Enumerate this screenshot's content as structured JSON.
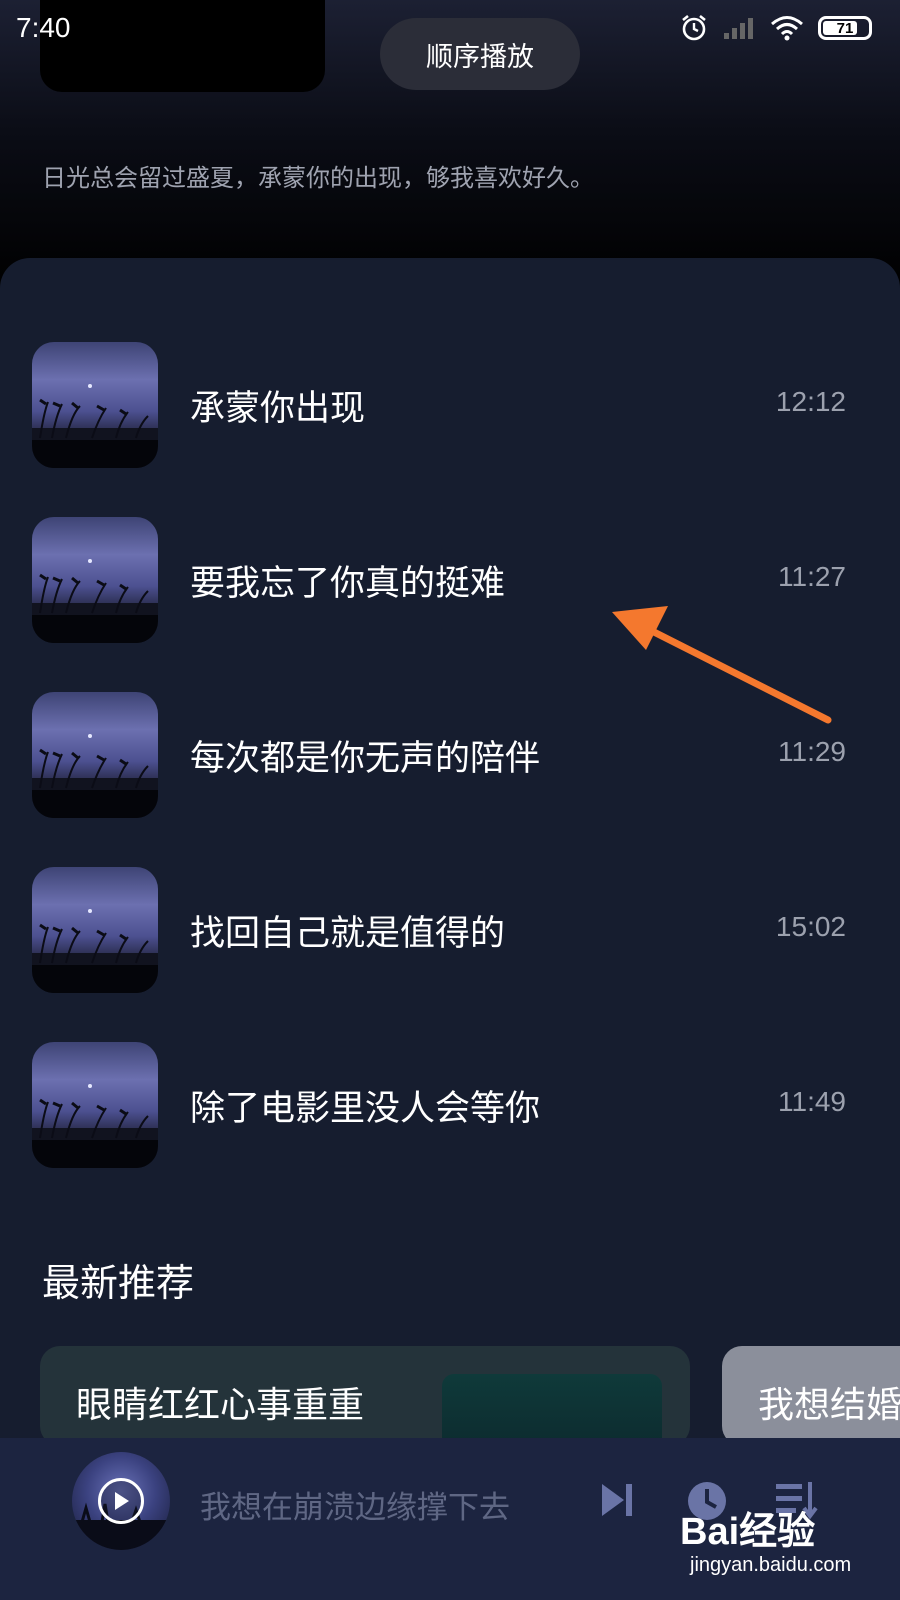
{
  "status_bar": {
    "time": "7:40",
    "battery": "71",
    "icons": [
      "alarm-icon",
      "signal-icon",
      "wifi-icon",
      "battery-icon"
    ]
  },
  "header": {
    "play_mode_label": "顺序播放",
    "description": "日光总会留过盛夏，承蒙你的出现，够我喜欢好久。"
  },
  "tracks": [
    {
      "title": "承蒙你出现",
      "duration": "12:12"
    },
    {
      "title": "要我忘了你真的挺难",
      "duration": "11:27"
    },
    {
      "title": "每次都是你无声的陪伴",
      "duration": "11:29"
    },
    {
      "title": "找回自己就是值得的",
      "duration": "15:02"
    },
    {
      "title": "除了电影里没人会等你",
      "duration": "11:49"
    }
  ],
  "recommend": {
    "section_title": "最新推荐",
    "cards": [
      {
        "title": "眼睛红红心事重重"
      },
      {
        "title": "我想结婚"
      }
    ]
  },
  "player": {
    "now_playing": "我想在崩溃边缘撑下去",
    "icons": [
      "play-icon",
      "next-track-icon",
      "timer-icon",
      "playlist-icon"
    ]
  },
  "annotation": {
    "arrow_color": "#f4782e"
  },
  "watermark": {
    "logo": "Bai经验",
    "url": "jingyan.baidu.com"
  },
  "colors": {
    "panel_bg": "#161d2f",
    "player_bg": "#1c2440",
    "muted_text": "#9ca1ae"
  }
}
